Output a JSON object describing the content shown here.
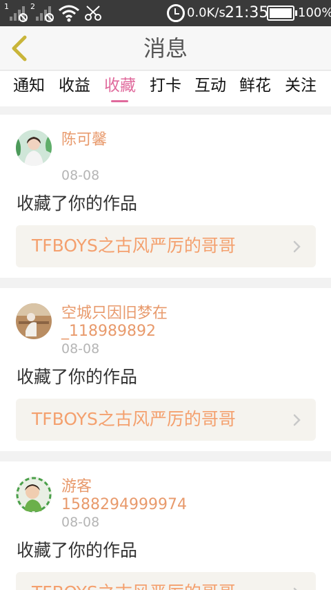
{
  "status_bar": {
    "sim1_label": "1",
    "sim2_label": "2",
    "net_speed": "0.0K/s",
    "time": "21:35",
    "battery_percent": "100%",
    "battery_level": 1.0
  },
  "header": {
    "title": "消息"
  },
  "tabs": [
    {
      "label": "通知",
      "active": false
    },
    {
      "label": "收益",
      "active": false
    },
    {
      "label": "收藏",
      "active": true
    },
    {
      "label": "打卡",
      "active": false
    },
    {
      "label": "互动",
      "active": false
    },
    {
      "label": "鲜花",
      "active": false
    },
    {
      "label": "关注",
      "active": false
    }
  ],
  "notifications": [
    {
      "user_name": "陈可馨",
      "date": "08-08",
      "action": "收藏了你的作品",
      "work_title": "TFBOYS之古风严厉的哥哥"
    },
    {
      "user_name": "空城只因旧梦在_118989892",
      "user_name_line1": "空城只因旧梦在",
      "user_name_line2": "_118989892",
      "date": "08-08",
      "action": "收藏了你的作品",
      "work_title": "TFBOYS之古风严厉的哥哥"
    },
    {
      "user_name": "游客1588294999974",
      "user_name_line1": "游客",
      "user_name_line2": "1588294999974",
      "date": "08-08",
      "action": "收藏了你的作品",
      "work_title": "TFBOYS之古风严厉的哥哥"
    }
  ],
  "colors": {
    "accent": "#e06a9c",
    "username": "#e89a6c",
    "work_title": "#f4a06e",
    "back_arrow": "#c9b53a"
  }
}
